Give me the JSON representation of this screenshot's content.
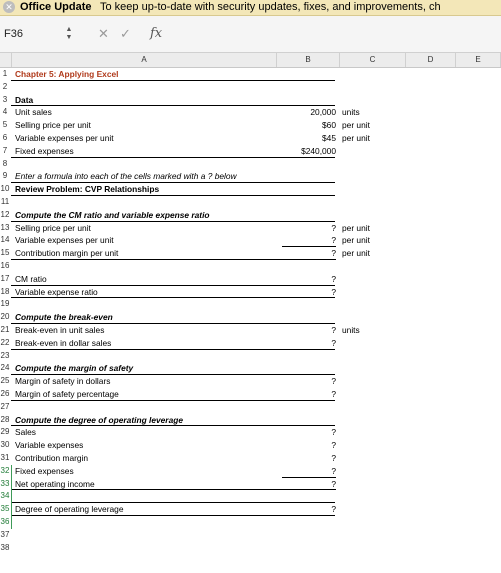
{
  "update_bar": {
    "title": "Office Update",
    "message": "To keep up-to-date with security updates, fixes, and improvements, ch"
  },
  "formula_bar": {
    "name_box": "F36",
    "formula": ""
  },
  "columns": [
    "A",
    "B",
    "C",
    "D",
    "E"
  ],
  "rows": [
    {
      "n": "1",
      "a": "Chapter 5: Applying Excel",
      "b": "",
      "c": "",
      "style": "title"
    },
    {
      "n": "2",
      "a": "",
      "b": "",
      "c": ""
    },
    {
      "n": "3",
      "a": "Data",
      "b": "",
      "c": "",
      "style": "bold"
    },
    {
      "n": "4",
      "a": "Unit sales",
      "b": "20,000",
      "c": "units"
    },
    {
      "n": "5",
      "a": "Selling price per unit",
      "b": "$60",
      "c": "per unit"
    },
    {
      "n": "6",
      "a": "Variable expenses per unit",
      "b": "$45",
      "c": "per unit"
    },
    {
      "n": "7",
      "a": "Fixed expenses",
      "b": "$240,000",
      "c": ""
    },
    {
      "n": "8",
      "a": "",
      "b": "",
      "c": ""
    },
    {
      "n": "9",
      "a": "Enter a formula into each of the cells marked with a ? below",
      "b": "",
      "c": "",
      "style": "italic"
    },
    {
      "n": "10",
      "a": "Review Problem: CVP Relationships",
      "b": "",
      "c": "",
      "style": "bold"
    },
    {
      "n": "11",
      "a": "",
      "b": "",
      "c": ""
    },
    {
      "n": "12",
      "a": "Compute the CM ratio and variable expense ratio",
      "b": "",
      "c": "",
      "style": "bold-italic"
    },
    {
      "n": "13",
      "a": "Selling price per unit",
      "b": "?",
      "c": "per unit"
    },
    {
      "n": "14",
      "a": "Variable expenses per unit",
      "b": "?",
      "c": "per unit"
    },
    {
      "n": "15",
      "a": "Contribution margin per unit",
      "b": "?",
      "c": "per unit"
    },
    {
      "n": "16",
      "a": "",
      "b": "",
      "c": ""
    },
    {
      "n": "17",
      "a": "CM ratio",
      "b": "?",
      "c": ""
    },
    {
      "n": "18",
      "a": "Variable expense ratio",
      "b": "?",
      "c": ""
    },
    {
      "n": "19",
      "a": "",
      "b": "",
      "c": ""
    },
    {
      "n": "20",
      "a": "Compute the break-even",
      "b": "",
      "c": "",
      "style": "bold-italic"
    },
    {
      "n": "21",
      "a": "Break-even in unit sales",
      "b": "?",
      "c": "units"
    },
    {
      "n": "22",
      "a": "Break-even in dollar sales",
      "b": "?",
      "c": ""
    },
    {
      "n": "23",
      "a": "",
      "b": "",
      "c": ""
    },
    {
      "n": "24",
      "a": "Compute the margin of safety",
      "b": "",
      "c": "",
      "style": "bold-italic"
    },
    {
      "n": "25",
      "a": "Margin of safety in dollars",
      "b": "?",
      "c": ""
    },
    {
      "n": "26",
      "a": "Margin of safety percentage",
      "b": "?",
      "c": ""
    },
    {
      "n": "27",
      "a": "",
      "b": "",
      "c": ""
    },
    {
      "n": "28",
      "a": "Compute the degree of operating leverage",
      "b": "",
      "c": "",
      "style": "bold-italic"
    },
    {
      "n": "29",
      "a": "Sales",
      "b": "?",
      "c": ""
    },
    {
      "n": "30",
      "a": "Variable expenses",
      "b": "?",
      "c": ""
    },
    {
      "n": "31",
      "a": "Contribution margin",
      "b": "?",
      "c": ""
    },
    {
      "n": "32",
      "a": "Fixed expenses",
      "b": "?",
      "c": ""
    },
    {
      "n": "33",
      "a": "Net operating income",
      "b": "?",
      "c": ""
    },
    {
      "n": "34",
      "a": "",
      "b": "",
      "c": ""
    },
    {
      "n": "35",
      "a": "Degree of operating leverage",
      "b": "?",
      "c": ""
    },
    {
      "n": "36",
      "a": "",
      "b": "",
      "c": ""
    },
    {
      "n": "37",
      "a": "",
      "b": "",
      "c": ""
    },
    {
      "n": "38",
      "a": "",
      "b": "",
      "c": ""
    }
  ],
  "colors": {
    "title_red": "#b03a1b",
    "selection_green": "#3e9a58",
    "update_bar_yellow": "#f3e7b8"
  }
}
